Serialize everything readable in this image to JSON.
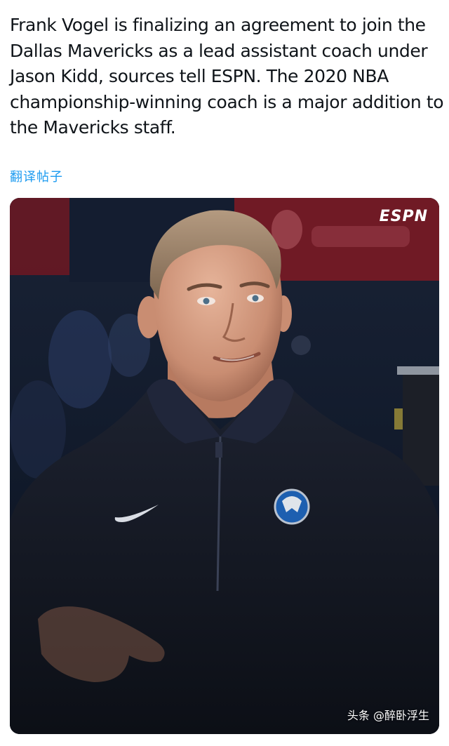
{
  "tweet": {
    "text_lines": [
      "Frank Vogel is finalizing an agreement to join the",
      "Dallas Mavericks as a lead assistant coach under",
      "Jason Kidd, sources tell ESPN. The 2020 NBA",
      "championship-winning coach is a major addition to",
      "the Mavericks staff."
    ],
    "translate_label": "翻译帖子"
  },
  "photo": {
    "logo_text": "ESPN",
    "watermark": "头条 @醉卧浮生"
  },
  "colors": {
    "text": "#0f1419",
    "link": "#1d9bf0",
    "jacket": "#141821",
    "background_banner": "#7a1a24"
  }
}
